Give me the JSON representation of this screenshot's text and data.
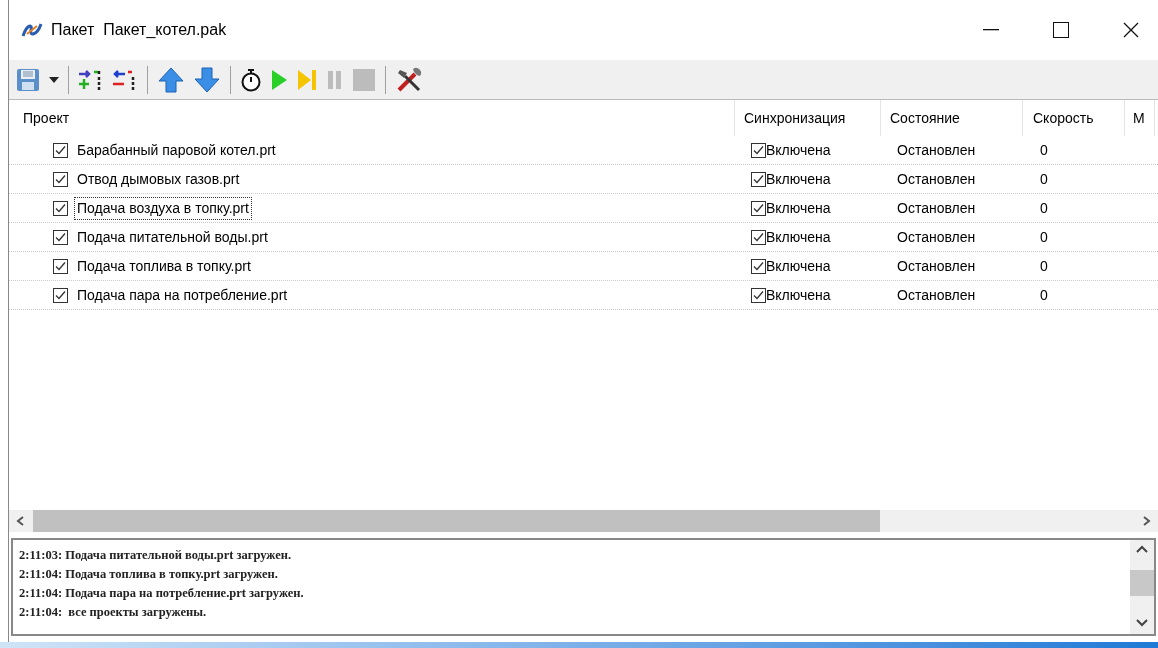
{
  "window": {
    "title": "Пакет  Пакет_котел.pak"
  },
  "toolbar": [
    {
      "kind": "save",
      "disabled": false
    },
    {
      "kind": "dropdown",
      "disabled": false
    },
    {
      "kind": "separator"
    },
    {
      "kind": "add",
      "disabled": false
    },
    {
      "kind": "remove",
      "disabled": false
    },
    {
      "kind": "separator"
    },
    {
      "kind": "up",
      "disabled": false
    },
    {
      "kind": "down",
      "disabled": false
    },
    {
      "kind": "separator"
    },
    {
      "kind": "timer",
      "disabled": false
    },
    {
      "kind": "play",
      "disabled": false
    },
    {
      "kind": "step",
      "disabled": false
    },
    {
      "kind": "pause",
      "disabled": true
    },
    {
      "kind": "stop",
      "disabled": true
    },
    {
      "kind": "separator"
    },
    {
      "kind": "tools",
      "disabled": false
    }
  ],
  "table": {
    "columns": [
      "Проект",
      "Синхронизация",
      "Состояние",
      "Скорость",
      "М"
    ],
    "rows": [
      {
        "name": "Барабанный паровой котел.prt",
        "checked": true,
        "focused": false,
        "sync": "Включена",
        "sync_checked": true,
        "state": "Остановлен",
        "speed": "0"
      },
      {
        "name": "Отвод дымовых газов.prt",
        "checked": true,
        "focused": false,
        "sync": "Включена",
        "sync_checked": true,
        "state": "Остановлен",
        "speed": "0"
      },
      {
        "name": "Подача воздуха в топку.prt",
        "checked": true,
        "focused": true,
        "sync": "Включена",
        "sync_checked": true,
        "state": "Остановлен",
        "speed": "0"
      },
      {
        "name": "Подача питательной воды.prt",
        "checked": true,
        "focused": false,
        "sync": "Включена",
        "sync_checked": true,
        "state": "Остановлен",
        "speed": "0"
      },
      {
        "name": "Подача топлива в топку.prt",
        "checked": true,
        "focused": false,
        "sync": "Включена",
        "sync_checked": true,
        "state": "Остановлен",
        "speed": "0"
      },
      {
        "name": "Подача пара на потребление.prt",
        "checked": true,
        "focused": false,
        "sync": "Включена",
        "sync_checked": true,
        "state": "Остановлен",
        "speed": "0"
      }
    ]
  },
  "log": [
    "2:11:03: Подача питательной воды.prt загружен.",
    "2:11:04: Подача топлива в топку.prt загружен.",
    "2:11:04: Подача пара на потребление.prt загружен.",
    "2:11:04:  все проекты загружены."
  ]
}
